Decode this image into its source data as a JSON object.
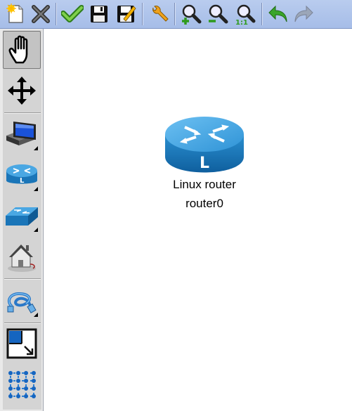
{
  "toolbar": {
    "buttons": [
      {
        "name": "new",
        "icon": "new-document-icon"
      },
      {
        "name": "close",
        "icon": "close-x-icon"
      },
      {
        "name": "check",
        "icon": "checkmark-icon"
      },
      {
        "name": "save",
        "icon": "floppy-save-icon"
      },
      {
        "name": "save-as",
        "icon": "floppy-edit-icon"
      },
      {
        "name": "settings",
        "icon": "wrench-icon"
      },
      {
        "name": "zoom-in",
        "icon": "zoom-in-icon"
      },
      {
        "name": "zoom-out",
        "icon": "zoom-out-icon"
      },
      {
        "name": "zoom-reset",
        "icon": "zoom-1-1-icon"
      },
      {
        "name": "undo",
        "icon": "undo-arrow-icon"
      },
      {
        "name": "redo",
        "icon": "redo-arrow-icon"
      }
    ]
  },
  "toolbox": {
    "tools": [
      {
        "name": "hand",
        "icon": "hand-pointer-icon",
        "selected": true
      },
      {
        "name": "move",
        "icon": "move-arrows-icon"
      },
      {
        "name": "computer",
        "icon": "computer-icon"
      },
      {
        "name": "router",
        "icon": "router-icon"
      },
      {
        "name": "switch",
        "icon": "switch-icon"
      },
      {
        "name": "internet",
        "icon": "house-internet-icon"
      },
      {
        "name": "cable",
        "icon": "ethernet-cable-icon"
      },
      {
        "name": "resize",
        "icon": "resize-corner-icon"
      },
      {
        "name": "grid",
        "icon": "grid-dots-icon"
      }
    ]
  },
  "canvas": {
    "node": {
      "icon": "linux-router-icon",
      "router_letter": "L",
      "type_label": "Linux router",
      "name_label": "router0"
    }
  },
  "colors": {
    "toolbar_bg": "#b0c4ec",
    "router_blue": "#1f86c8",
    "accent_green": "#3a9a2a"
  }
}
